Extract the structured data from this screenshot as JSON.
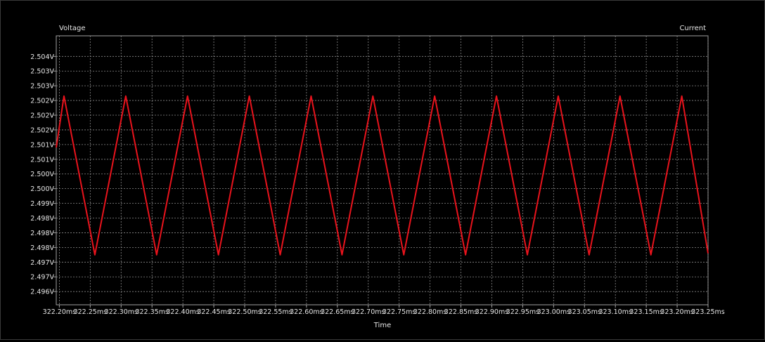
{
  "chart_data": {
    "type": "line",
    "xlabel": "Time",
    "ylabel_left": "Voltage",
    "ylabel_right": "Current",
    "grid": true,
    "background": "#000000",
    "grid_color": "#8a8a8a",
    "axis_color": "#a0a0a0",
    "series_color": "#e8131c",
    "xlim_ms": [
      322.195,
      323.25
    ],
    "x_ticks_ms": [
      322.2,
      322.25,
      322.3,
      322.35,
      322.4,
      322.45,
      322.5,
      322.55,
      322.6,
      322.65,
      322.7,
      322.75,
      322.8,
      322.85,
      322.9,
      322.95,
      323.0,
      323.05,
      323.1,
      323.15,
      323.2,
      323.25
    ],
    "x_tick_labels": [
      "322.20ms",
      "322.25ms",
      "322.30ms",
      "322.35ms",
      "322.40ms",
      "322.45ms",
      "322.50ms",
      "322.55ms",
      "322.60ms",
      "322.65ms",
      "322.70ms",
      "322.75ms",
      "322.80ms",
      "322.85ms",
      "322.90ms",
      "322.95ms",
      "323.00ms",
      "323.05ms",
      "323.10ms",
      "323.15ms",
      "323.20ms",
      "323.25ms"
    ],
    "ylim_V": [
      2.49555,
      2.5047
    ],
    "y_ticks_V": [
      2.504,
      2.5035,
      2.503,
      2.5025,
      2.502,
      2.5015,
      2.501,
      2.5005,
      2.5,
      2.4995,
      2.499,
      2.4985,
      2.498,
      2.4975,
      2.497,
      2.4965,
      2.496
    ],
    "y_tick_labels": [
      "2.504V",
      "2.503V",
      "2.503V",
      "2.502V",
      "2.502V",
      "2.502V",
      "2.501V",
      "2.501V",
      "2.500V",
      "2.500V",
      "2.499V",
      "2.498V",
      "2.498V",
      "2.498V",
      "2.497V",
      "2.497V",
      "2.496V"
    ],
    "series": [
      {
        "x_ms": [
          322.195,
          322.2075,
          322.2575,
          322.3075,
          322.3575,
          322.4075,
          322.4575,
          322.5075,
          322.5575,
          322.6075,
          322.6575,
          322.7075,
          322.7575,
          322.8075,
          322.8575,
          322.9075,
          322.9575,
          323.0075,
          323.0575,
          323.1075,
          323.1575,
          323.2075,
          323.25
        ],
        "y_V": [
          2.5009,
          2.50265,
          2.49725,
          2.50265,
          2.49725,
          2.50265,
          2.49725,
          2.50265,
          2.49725,
          2.50265,
          2.49725,
          2.50265,
          2.49725,
          2.50265,
          2.49725,
          2.50265,
          2.49725,
          2.50265,
          2.49725,
          2.50265,
          2.49725,
          2.50265,
          2.4973
        ]
      }
    ]
  }
}
